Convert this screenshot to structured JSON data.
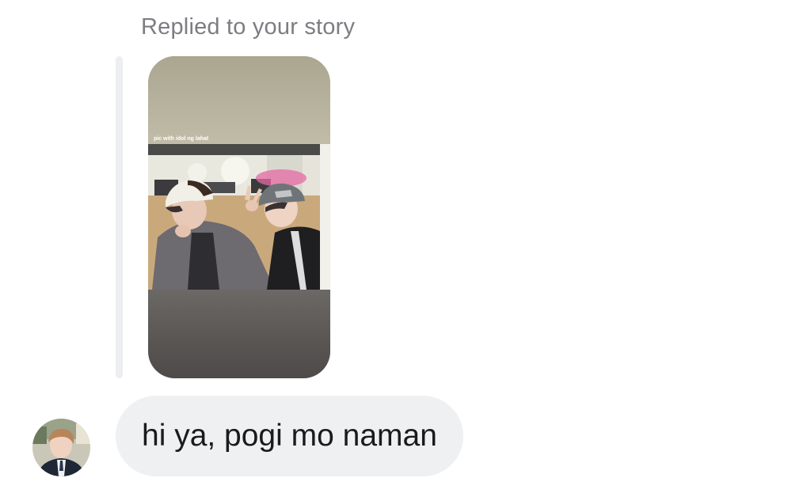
{
  "reply_header": "Replied to your story",
  "story": {
    "caption": "pic with idol ng lahat",
    "image": "story-photo-two-people-selfie"
  },
  "message": {
    "text": "hi ya, pogi mo naman"
  },
  "sender": {
    "avatar": "sender-avatar-photo"
  },
  "colors": {
    "bubble_background": "#eff0f2",
    "header_text": "#7c7d82",
    "quote_bar": "#eceef1"
  }
}
